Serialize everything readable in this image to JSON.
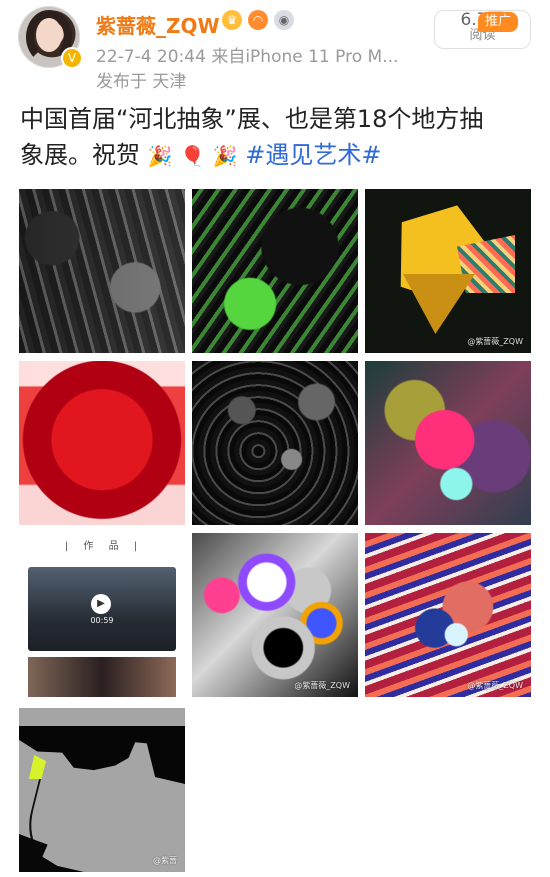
{
  "header": {
    "username": "紫蔷薇_ZQW",
    "meta": "22-7-4 20:44  来自iPhone 11 Pro M...",
    "location": "发布于 天津",
    "reads_count": "6.7万",
    "reads_label": "阅读",
    "promo_tag": "推广"
  },
  "post": {
    "line1": "中国首届“河北抽象”展、也是第18个地方抽",
    "line2_prefix": "象展。祝贺",
    "line2_hashtag": "#遇见艺术#",
    "emoji": [
      "🎉",
      "🎈",
      "🎉"
    ]
  },
  "video": {
    "tab_label": "| 作 品 |",
    "time": "00:59"
  },
  "watermarks": {
    "w3": "@紫蔷薇_ZQW",
    "w8": "@紫蔷薇_ZQW",
    "w9": "@紫蔷薇_ZQW",
    "w10": "@紫蔷"
  },
  "icons": {
    "verified": "verified-icon",
    "crown": "crown-icon",
    "hat": "hat-icon",
    "medal": "medal-icon",
    "play": "play-icon"
  }
}
